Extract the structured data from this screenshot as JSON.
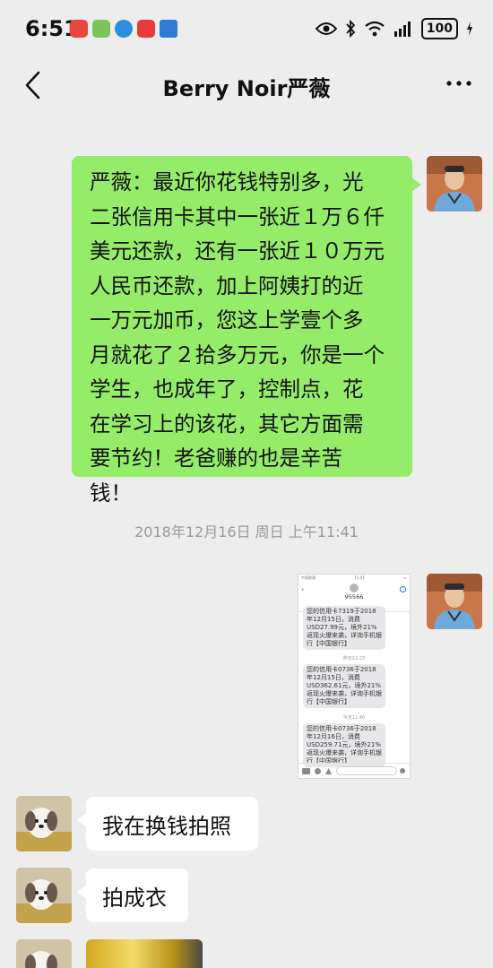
{
  "status_bar": {
    "time": "6:51",
    "battery": "100",
    "app_icon_colors": [
      "#e8473f",
      "#7cc35a",
      "#2a8fe0",
      "#e83a3a",
      "#2f7bd6"
    ]
  },
  "header": {
    "back_icon": "chevron-left-icon",
    "title": "Berry Noir严薇",
    "more_icon": "more-dots-icon"
  },
  "messages": {
    "m1": {
      "sender": "me",
      "lines": [
        "严薇：最近你花钱特别多，光",
        "二张信用卡其中一张近１万６仟",
        "美元还款，还有一张近１０万元",
        "人民币还款，加上阿姨打的近",
        "一万元加币，您这上学壹个多",
        "月就花了２拾多万元，你是一个",
        "学生，也成年了，控制点，花",
        "在学习上的该花，其它方面需",
        "要节约！老爸赚的也是辛苦",
        "钱！"
      ]
    },
    "timestamp": "2018年12月16日 周日 上午11:41",
    "m2": {
      "sender": "me",
      "type": "image",
      "sms": {
        "carrier": "中国联通",
        "clock": "11:41",
        "number": "95566",
        "day_label_1": "昨天22:23",
        "day_label_2": "今天11:40",
        "msg1": "您的信用卡7319于2018年12月15日，消费USD27.99元，境外21%返现火爆来袭，详询手机银行【中国银行】",
        "msg2": "您的信用卡0736于2018年12月15日，消费USD362.61元，境外21%返现火爆来袭，详询手机银行【中国银行】",
        "msg3": "您的信用卡0736于2018年12月16日，消费USD259.71元，境外21%返现火爆来袭，详询手机银行【中国银行】"
      }
    },
    "m3": {
      "sender": "other",
      "text": "我在换钱拍照"
    },
    "m4": {
      "sender": "other",
      "text": "拍成衣"
    },
    "m5": {
      "sender": "other",
      "type": "image"
    }
  },
  "colors": {
    "background": "#ededed",
    "my_bubble": "#95ec69",
    "other_bubble": "#ffffff",
    "timestamp": "#9a9a9a"
  }
}
